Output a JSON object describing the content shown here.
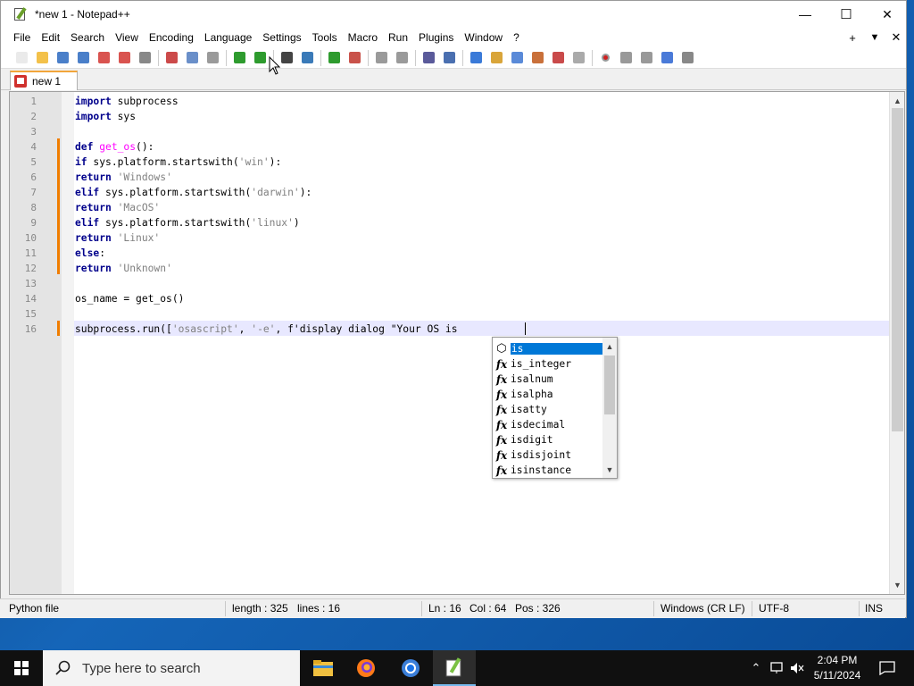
{
  "window": {
    "title": "*new 1 - Notepad++",
    "minimize": "—",
    "maximize": "☐",
    "close": "✕"
  },
  "menu": {
    "items": [
      "File",
      "Edit",
      "Search",
      "View",
      "Encoding",
      "Language",
      "Settings",
      "Tools",
      "Macro",
      "Run",
      "Plugins",
      "Window",
      "?"
    ],
    "right_plus": "+",
    "right_down": "▼",
    "right_close": "✕"
  },
  "toolbar": {
    "icons": [
      "new-icon",
      "open-icon",
      "save-icon",
      "save-all-icon",
      "close-icon",
      "close-all-icon",
      "print-icon",
      "cut-icon",
      "copy-icon",
      "paste-icon",
      "undo-icon",
      "redo-icon",
      "find-icon",
      "replace-icon",
      "zoom-in-icon",
      "zoom-out-icon",
      "sync-vertical-icon",
      "sync-horizontal-icon",
      "word-wrap-icon",
      "show-all-chars-icon",
      "indent-guide-icon",
      "doc-map-icon",
      "function-list-icon",
      "folder-workspace-icon",
      "doc-list-icon",
      "monitoring-icon",
      "record-macro-icon",
      "stop-macro-icon",
      "play-macro-icon",
      "run-macro-multiple-icon",
      "save-macro-icon"
    ]
  },
  "tab": {
    "label": "new 1",
    "icon": "unsaved-file-icon"
  },
  "editor": {
    "line_numbers": [
      "1",
      "2",
      "3",
      "4",
      "5",
      "6",
      "7",
      "8",
      "9",
      "10",
      "11",
      "12",
      "13",
      "14",
      "15",
      "16"
    ],
    "lines": [
      [
        {
          "t": "import",
          "c": "kw"
        },
        {
          "t": " subprocess",
          "c": ""
        }
      ],
      [
        {
          "t": "import",
          "c": "kw"
        },
        {
          "t": " sys",
          "c": ""
        }
      ],
      [],
      [
        {
          "t": "def",
          "c": "kw"
        },
        {
          "t": " ",
          "c": ""
        },
        {
          "t": "get_os",
          "c": "fn"
        },
        {
          "t": "():",
          "c": ""
        }
      ],
      [
        {
          "t": "if",
          "c": "kw"
        },
        {
          "t": " sys.platform.startswith(",
          "c": ""
        },
        {
          "t": "'win'",
          "c": "str"
        },
        {
          "t": "):",
          "c": ""
        }
      ],
      [
        {
          "t": "return",
          "c": "kw"
        },
        {
          "t": " ",
          "c": ""
        },
        {
          "t": "'Windows'",
          "c": "str"
        }
      ],
      [
        {
          "t": "elif",
          "c": "kw"
        },
        {
          "t": " sys.platform.startswith(",
          "c": ""
        },
        {
          "t": "'darwin'",
          "c": "str"
        },
        {
          "t": "):",
          "c": ""
        }
      ],
      [
        {
          "t": "return",
          "c": "kw"
        },
        {
          "t": " ",
          "c": ""
        },
        {
          "t": "'MacOS'",
          "c": "str"
        }
      ],
      [
        {
          "t": "elif",
          "c": "kw"
        },
        {
          "t": " sys.platform.startswith(",
          "c": ""
        },
        {
          "t": "'linux'",
          "c": "str"
        },
        {
          "t": ")",
          "c": ""
        }
      ],
      [
        {
          "t": "return",
          "c": "kw"
        },
        {
          "t": " ",
          "c": ""
        },
        {
          "t": "'Linux'",
          "c": "str"
        }
      ],
      [
        {
          "t": "else",
          "c": "kw"
        },
        {
          "t": ":",
          "c": ""
        }
      ],
      [
        {
          "t": "return",
          "c": "kw"
        },
        {
          "t": " ",
          "c": ""
        },
        {
          "t": "'Unknown'",
          "c": "str"
        }
      ],
      [],
      [
        {
          "t": "os_name = get_os()",
          "c": ""
        }
      ],
      [],
      [
        {
          "t": "subprocess.run([",
          "c": ""
        },
        {
          "t": "'osascript'",
          "c": "str"
        },
        {
          "t": ", ",
          "c": ""
        },
        {
          "t": "'-e'",
          "c": "str"
        },
        {
          "t": ", f'display dialog \"Your OS is",
          "c": ""
        }
      ]
    ],
    "scroll_up": "▲",
    "scroll_down": "▼"
  },
  "autocomplete": {
    "items": [
      {
        "label": "is",
        "icon": "keyword-cube-icon",
        "glyph": "⬡"
      },
      {
        "label": "is_integer",
        "icon": "function-icon",
        "glyph": "fx"
      },
      {
        "label": "isalnum",
        "icon": "function-icon",
        "glyph": "fx"
      },
      {
        "label": "isalpha",
        "icon": "function-icon",
        "glyph": "fx"
      },
      {
        "label": "isatty",
        "icon": "function-icon",
        "glyph": "fx"
      },
      {
        "label": "isdecimal",
        "icon": "function-icon",
        "glyph": "fx"
      },
      {
        "label": "isdigit",
        "icon": "function-icon",
        "glyph": "fx"
      },
      {
        "label": "isdisjoint",
        "icon": "function-icon",
        "glyph": "fx"
      },
      {
        "label": "isinstance",
        "icon": "function-icon",
        "glyph": "fx"
      }
    ],
    "scroll_up": "▲",
    "scroll_down": "▼"
  },
  "status": {
    "filetype": "Python file",
    "length": "length : 325",
    "lines": "lines : 16",
    "ln": "Ln : 16",
    "col": "Col : 64",
    "pos": "Pos : 326",
    "eol": "Windows (CR LF)",
    "encoding": "UTF-8",
    "mode": "INS"
  },
  "taskbar": {
    "search_placeholder": "Type here to search",
    "time": "2:04 PM",
    "date": "5/11/2024",
    "apps": [
      "file-explorer-icon",
      "firefox-icon",
      "chrome-icon",
      "notepadpp-icon"
    ],
    "colors": {
      "accent": "#0078d7",
      "bar": "#101010"
    }
  }
}
